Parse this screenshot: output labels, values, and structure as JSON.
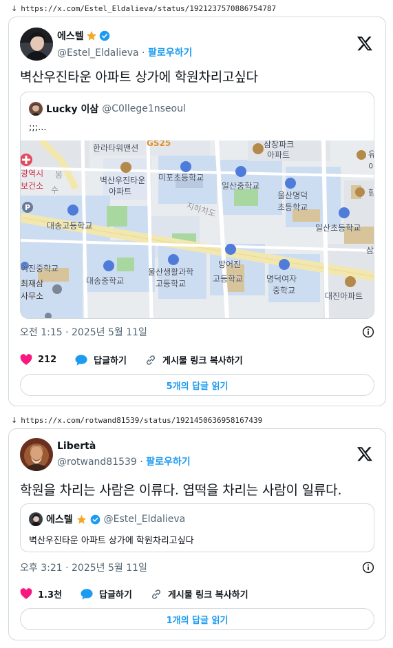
{
  "captures": [
    {
      "url": "https://x.com/Estel_Eldalieva/status/1921237570886754787",
      "author": {
        "name": "에스텔",
        "handle": "@Estel_Eldalieva",
        "follow": "팔로우하기",
        "verified": true,
        "badge_color": "#f5a623"
      },
      "text": "벽산우진타운 아파트 상가에 학원차리고싶다",
      "quote": {
        "name": "Lucky 이삼",
        "handle": "@C0llege1nseoul",
        "text": ";;;...",
        "map_labels": {
          "hanra": "한라타워맨션",
          "gs25": "GS25",
          "samjang": "삼장파크",
          "samjang2": "아파트",
          "yu": "유",
          "o": "이",
          "gwangyeok": "광역시",
          "geonso": "보건소",
          "bong": "봉",
          "su": "수",
          "byeoksan": "벽산우진타운",
          "byeoksan2": "아파트",
          "mipo": "미포초등학교",
          "ilsan_mid": "일산중학교",
          "ulsan_myeong": "울산명덕",
          "ulsan_myeong2": "초등학교",
          "jiha": "지하차도",
          "daesong_high": "대송고등학교",
          "ilsan_elem": "일산초등학교",
          "ham": "함",
          "sam": "삼",
          "eojin": "어진중학교",
          "daesong_mid": "대송중학교",
          "ulsan_life": "울산생활과학",
          "ulsan_life2": "고등학교",
          "bangeojin": "방어진",
          "bangeojin2": "고등학교",
          "myeongdeok": "명덕여자",
          "myeongdeok2": "중학교",
          "choejae": "최재삼",
          "choejae2": "사무소",
          "daejin": "대진아파트"
        }
      },
      "timestamp": "오전 1:15 · 2025년 5월 11일",
      "actions": {
        "likes": "212",
        "reply": "답글하기",
        "copy": "게시물 링크 복사하기"
      },
      "read_replies": "5개의 답글 읽기"
    },
    {
      "url": "https://x.com/rotwand81539/status/1921450636958167439",
      "author": {
        "name": "Libertà",
        "handle": "@rotwand81539",
        "follow": "팔로우하기",
        "verified": false
      },
      "text": "학원을 차리는 사람은 이류다. 엽떡을 차리는 사람이 일류다.",
      "quote": {
        "name": "에스텔",
        "handle": "@Estel_Eldalieva",
        "text": "벽산우진타운 아파트 상가에 학원차리고싶다"
      },
      "timestamp": "오후 3:21 · 2025년 5월 11일",
      "actions": {
        "likes": "1.3천",
        "reply": "답글하기",
        "copy": "게시물 링크 복사하기"
      },
      "read_replies": "1개의 답글 읽기"
    }
  ],
  "colors": {
    "like": "#f91880",
    "reply": "#1d9bf0",
    "link": "#1d9bf0",
    "verified": "#1d9bf0"
  }
}
